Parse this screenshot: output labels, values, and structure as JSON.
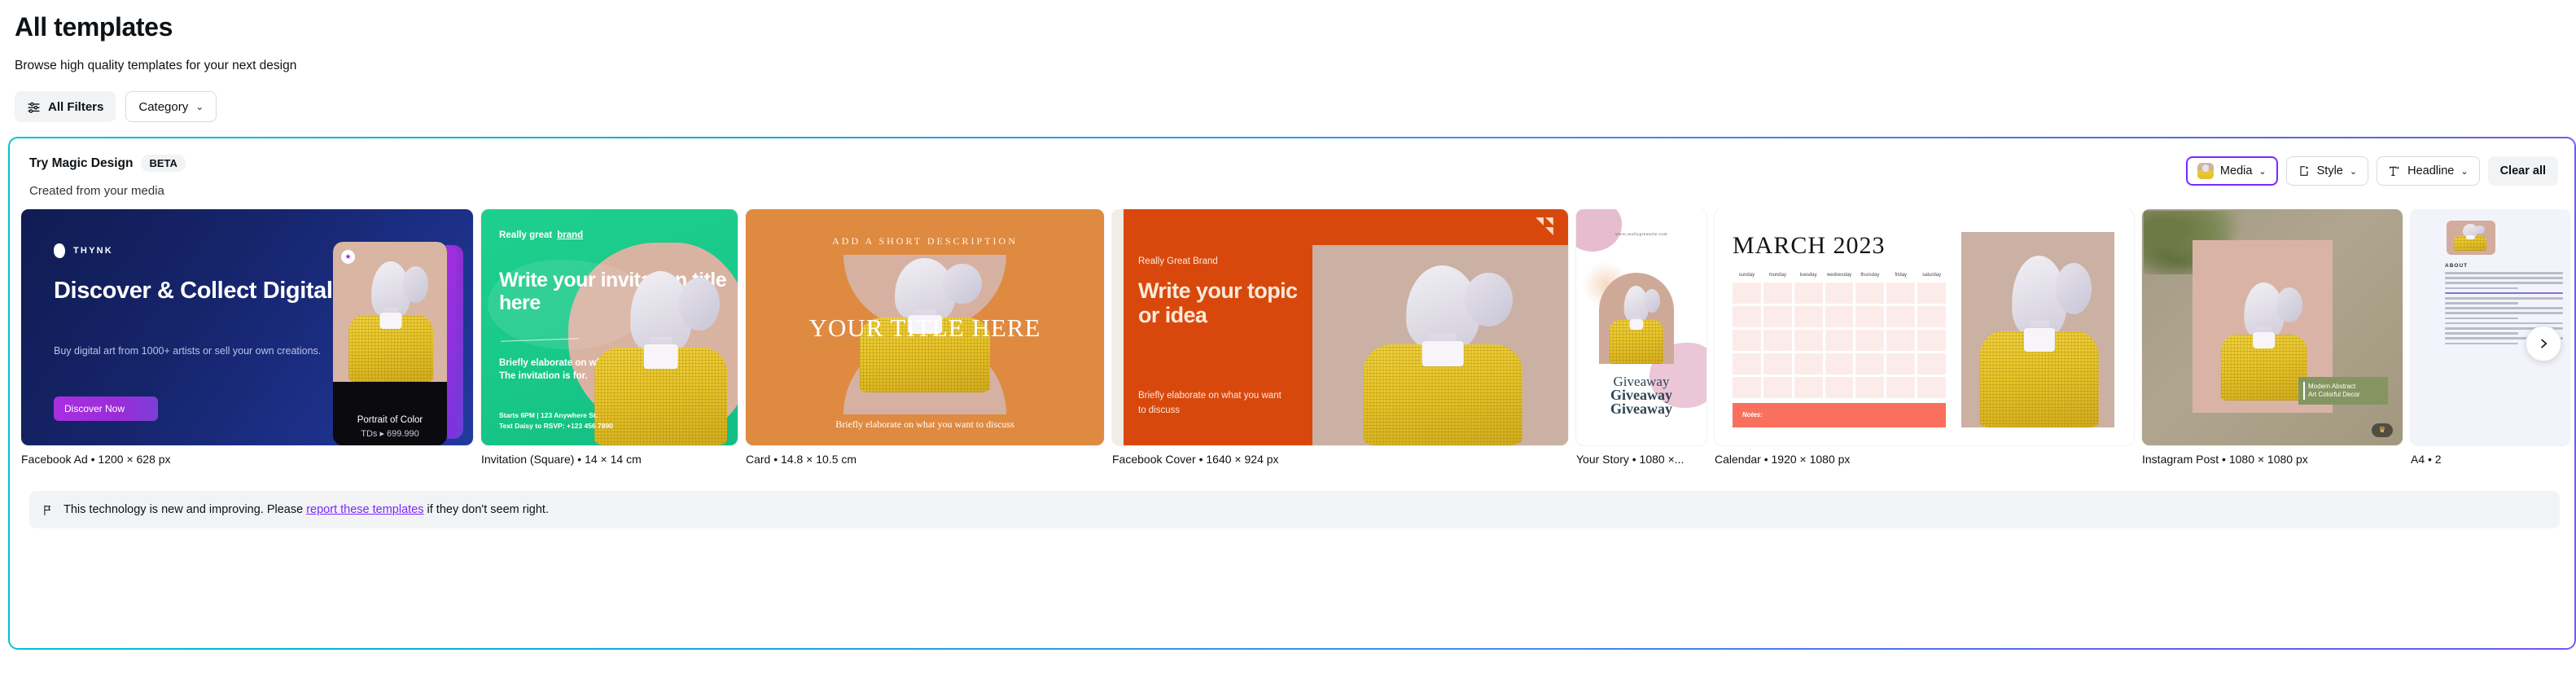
{
  "header": {
    "title": "All templates",
    "subtitle": "Browse high quality templates for your next design"
  },
  "filters": {
    "all_filters_label": "All Filters",
    "all_filters_icon": "sliders-icon",
    "category_label": "Category",
    "category_caret": "⌄"
  },
  "magic": {
    "title": "Try Magic Design",
    "badge": "BETA",
    "created_from": "Created from your media",
    "controls": [
      {
        "label": "Media",
        "caret": "⌄",
        "icon": "media-thumbnail-icon",
        "selected": true,
        "accent": "#7a28ff"
      },
      {
        "label": "Style",
        "caret": "⌄",
        "icon": "style-sparkle-icon",
        "selected": false
      },
      {
        "label": "Headline",
        "caret": "⌄",
        "icon": "text-sparkle-icon",
        "selected": false
      }
    ],
    "clear_all_label": "Clear all",
    "next_icon": "chevron-right-icon",
    "border_gradient_start": "#00c4cc",
    "border_gradient_end": "#6a5cf5"
  },
  "cards": [
    {
      "caption": "Facebook Ad • 1200 × 628 px",
      "brand": "THYNK",
      "heading": "Discover & Collect Digital Arts",
      "body": "Buy digital art from 1000+ artists or sell your own creations.",
      "button": "Discover Now",
      "nft_name": "Portrait of Color",
      "nft_price": "TDs  ▸  699.990",
      "star": "★"
    },
    {
      "caption": "Invitation (Square) • 14 × 14 cm",
      "brand_prefix": "Really great",
      "brand_word": "brand",
      "heading": "Write your invitation title here",
      "body": "Briefly elaborate on what The invitation is for.",
      "footer_line1": "Starts 6PM | 123 Anywhere St.",
      "footer_line2": "Text Daisy to RSVP: +123 456 7890"
    },
    {
      "caption": "Card • 14.8 × 10.5 cm",
      "kicker": "ADD A SHORT DESCRIPTION",
      "heading": "YOUR TITLE HERE",
      "body": "Briefly elaborate on what you want to discuss"
    },
    {
      "caption": "Facebook Cover • 1640 × 924 px",
      "brand": "Really Great Brand",
      "heading": "Write your topic or idea",
      "body": "Briefly elaborate on what you want to discuss"
    },
    {
      "caption": "Your Story • 1080 ×...",
      "url": "www.reallygreatsite.com",
      "word1": "Giveaway",
      "word2": "Giveaway",
      "word3": "Giveaway"
    },
    {
      "caption": "Calendar • 1920 × 1080 px",
      "month_title": "MARCH 2023",
      "weekdays": [
        "sunday",
        "monday",
        "tuesday",
        "wednesday",
        "thursday",
        "friday",
        "saturday"
      ],
      "notes_label": "Notes:"
    },
    {
      "caption": "Instagram Post • 1080 × 1080 px",
      "tag_line1": "Modern Abstract",
      "tag_line2": "Art Colorful Decor",
      "crown": "♛"
    },
    {
      "caption": "A4 • 2",
      "about_heading": "ABOUT"
    }
  ],
  "disclaimer": {
    "icon": "flag-icon",
    "text_before": "This technology is new and improving. Please ",
    "link": "report these templates",
    "text_after": " if they don't seem right."
  }
}
